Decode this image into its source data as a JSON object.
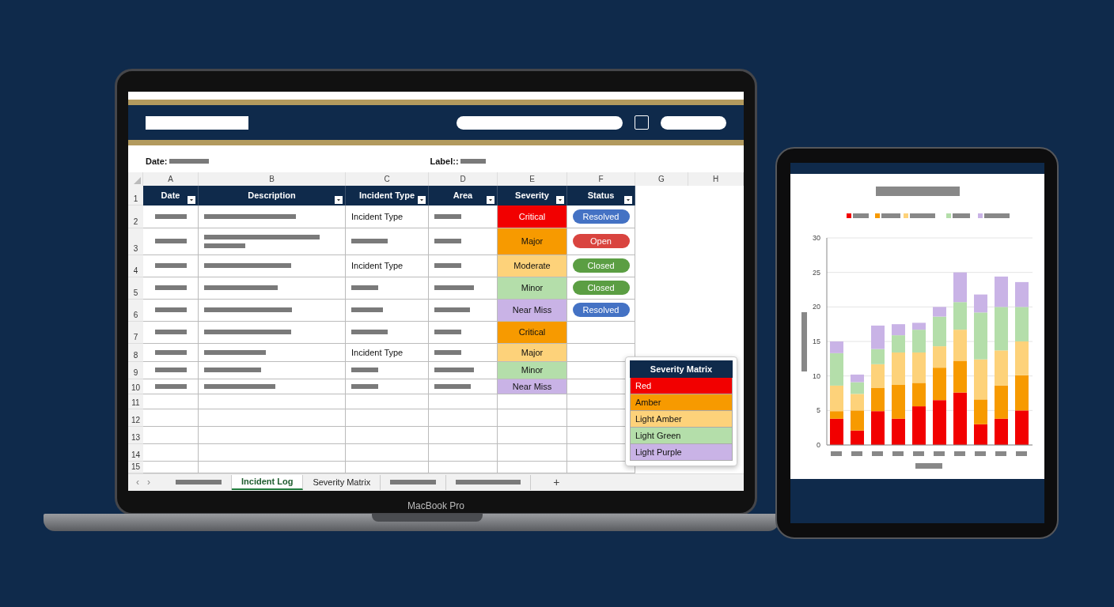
{
  "info": {
    "date_label": "Date:",
    "label_label": "Label::"
  },
  "column_letters": [
    "A",
    "B",
    "C",
    "D",
    "E",
    "F",
    "G",
    "H"
  ],
  "header_row_number": "1",
  "headers": [
    "Date",
    "Description",
    "Incident Type",
    "Area",
    "Severity",
    "Status"
  ],
  "rows": [
    {
      "number": "2",
      "kind": "single",
      "incident_type": "Incident Type",
      "severity": {
        "text": "Critical",
        "color": "#f20000"
      },
      "status": {
        "text": "Resolved",
        "color": "#4472c4"
      }
    },
    {
      "number": "3",
      "kind": "double",
      "severity": {
        "text": "Major",
        "color": "#f79a00"
      },
      "status": {
        "text": "Open",
        "color": "#d9443f"
      }
    },
    {
      "number": "4",
      "kind": "single",
      "incident_type": "Incident Type",
      "severity": {
        "text": "Moderate",
        "color": "#fdd27a"
      },
      "status": {
        "text": "Closed",
        "color": "#5b9e43"
      }
    },
    {
      "number": "5",
      "kind": "single",
      "severity": {
        "text": "Minor",
        "color": "#b4deaa"
      },
      "status": {
        "text": "Closed",
        "color": "#5b9e43"
      }
    },
    {
      "number": "6",
      "kind": "single",
      "severity": {
        "text": "Near Miss",
        "color": "#c9b3e6"
      },
      "status": {
        "text": "Resolved",
        "color": "#4472c4"
      }
    },
    {
      "number": "7",
      "kind": "single",
      "severity": {
        "text": "Critical",
        "color": "#f79a00"
      }
    },
    {
      "number": "8",
      "kind": "single",
      "incident_type": "Incident Type",
      "severity": {
        "text": "Major",
        "color": "#fdd27a"
      }
    },
    {
      "number": "9",
      "kind": "single",
      "severity": {
        "text": "Minor",
        "color": "#b4deaa"
      }
    },
    {
      "number": "10",
      "kind": "single",
      "severity": {
        "text": "Near Miss",
        "color": "#c9b3e6"
      }
    }
  ],
  "empty_rows": [
    "11",
    "12",
    "13",
    "14",
    "15"
  ],
  "severity_matrix": {
    "title": "Severity Matrix",
    "items": [
      {
        "label": "Red",
        "color": "#f20000"
      },
      {
        "label": "Amber",
        "color": "#f79a00"
      },
      {
        "label": "Light Amber",
        "color": "#fdd27a"
      },
      {
        "label": "Light Green",
        "color": "#b4deaa"
      },
      {
        "label": "Light Purple",
        "color": "#c9b3e6"
      }
    ]
  },
  "sheet_tabs": {
    "prev": "‹",
    "next": "›",
    "add": "+",
    "tabs": [
      {
        "kind": "redacted",
        "selected": false
      },
      {
        "kind": "label",
        "label": "Incident Log",
        "selected": true
      },
      {
        "kind": "label",
        "label": "Severity Matrix",
        "selected": false
      },
      {
        "kind": "redacted",
        "selected": false
      },
      {
        "kind": "redacted",
        "selected": false
      }
    ]
  },
  "laptop_label": "MacBook Pro",
  "tablet_chart": {
    "chart_data": {
      "type": "bar",
      "stacked": true,
      "grid": true,
      "ylim": [
        0,
        30
      ],
      "yticks": [
        0,
        5,
        10,
        15,
        20,
        25,
        30
      ],
      "series": [
        {
          "color": "#f20000",
          "values": [
            3.8,
            2.1,
            4.9,
            3.8,
            5.6,
            6.5,
            7.6,
            3.0,
            3.8,
            5.0
          ]
        },
        {
          "color": "#f79a00",
          "values": [
            1.1,
            2.9,
            3.4,
            4.9,
            3.4,
            4.7,
            4.6,
            3.6,
            4.8,
            5.1
          ]
        },
        {
          "color": "#fdd27a",
          "values": [
            3.7,
            2.4,
            3.4,
            4.7,
            4.4,
            3.1,
            4.5,
            5.8,
            5.1,
            4.9
          ]
        },
        {
          "color": "#b4deaa",
          "values": [
            4.7,
            1.7,
            2.2,
            2.5,
            3.3,
            4.3,
            4.0,
            6.8,
            6.3,
            5.0
          ]
        },
        {
          "color": "#c9b3e6",
          "values": [
            1.7,
            1.1,
            3.4,
            1.6,
            1.0,
            1.4,
            4.3,
            2.6,
            4.4,
            3.6
          ]
        }
      ]
    }
  }
}
